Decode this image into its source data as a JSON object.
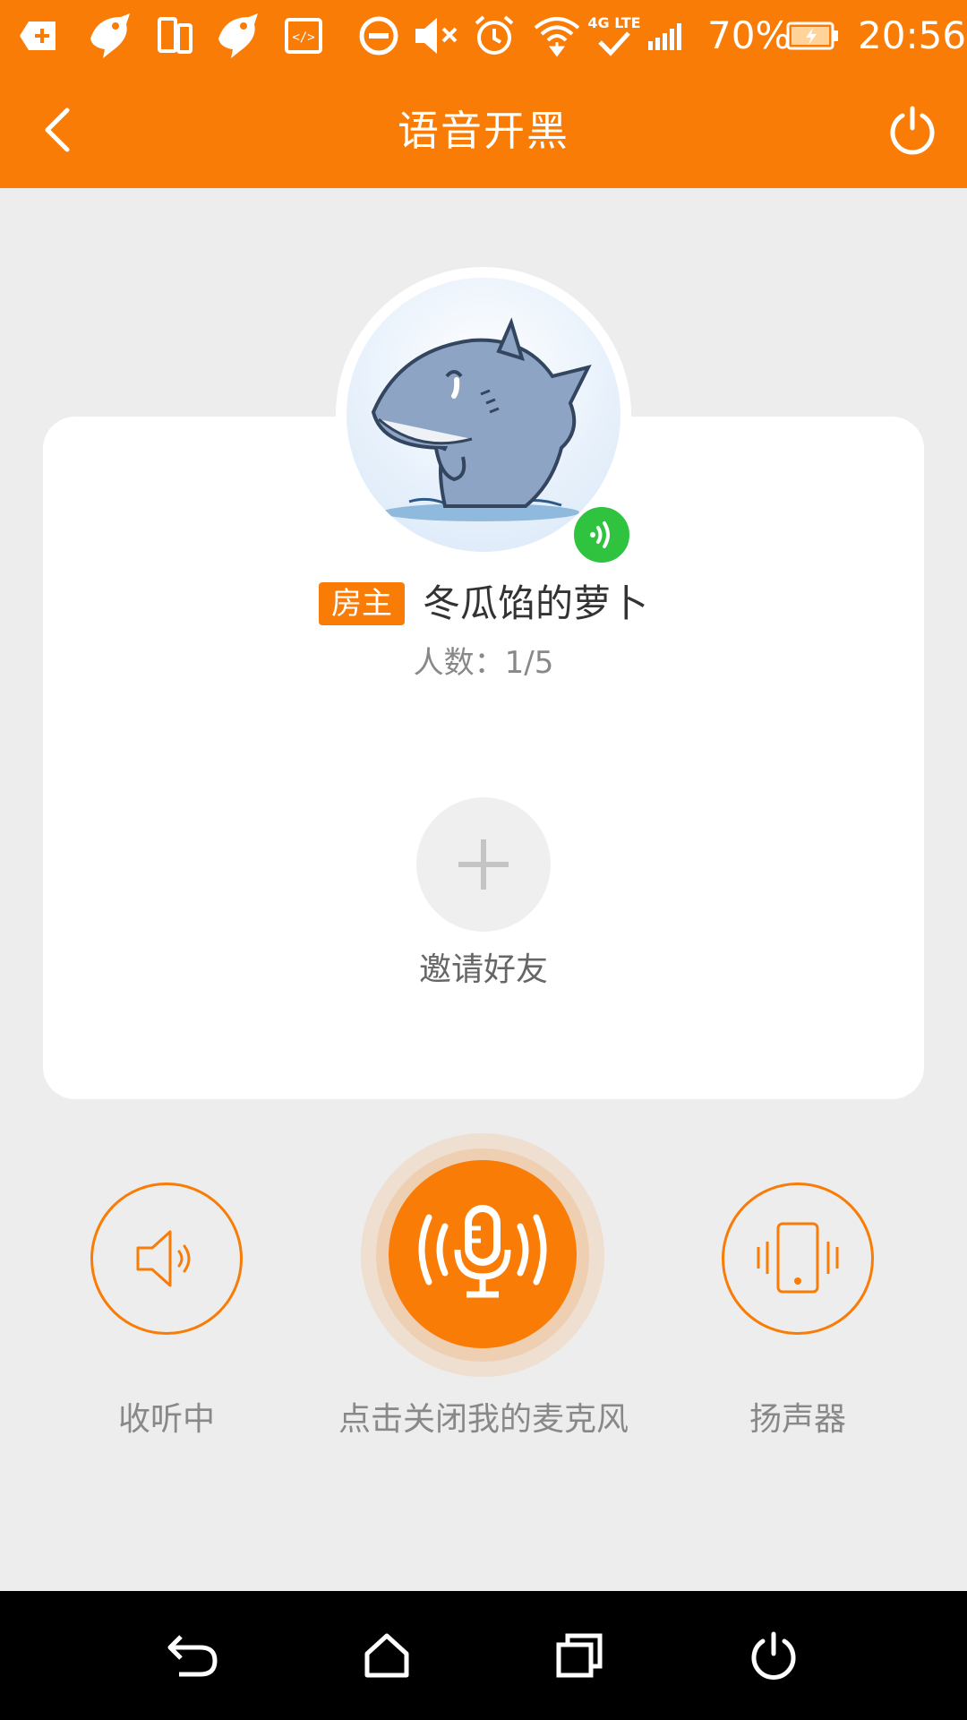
{
  "status_bar": {
    "battery_percent": "70%",
    "time": "20:56",
    "network_type": "4G LTE",
    "icons": [
      "notification-plus-icon",
      "shark-app-icon",
      "dual-screen-icon",
      "shark-app-icon",
      "code-icon",
      "do-not-disturb-icon",
      "mute-icon",
      "alarm-icon",
      "wifi-icon",
      "lte-check-icon",
      "signal-icon",
      "battery-charging-icon"
    ]
  },
  "app_bar": {
    "title": "语音开黑",
    "back_icon": "chevron-left-icon",
    "exit_icon": "power-icon"
  },
  "room": {
    "owner_tag": "房主",
    "owner_name": "冬瓜馅的萝卜",
    "member_count": "人数：1/5",
    "invite_label": "邀请好友"
  },
  "controls": {
    "listen_label": "收听中",
    "mic_label": "点击关闭我的麦克风",
    "speaker_label": "扬声器"
  },
  "colors": {
    "accent": "#f97c06",
    "voice_active": "#2fc340",
    "background": "#ededed"
  },
  "nav_bar": {
    "icons": [
      "back-icon",
      "home-icon",
      "recents-icon",
      "power-icon"
    ]
  }
}
